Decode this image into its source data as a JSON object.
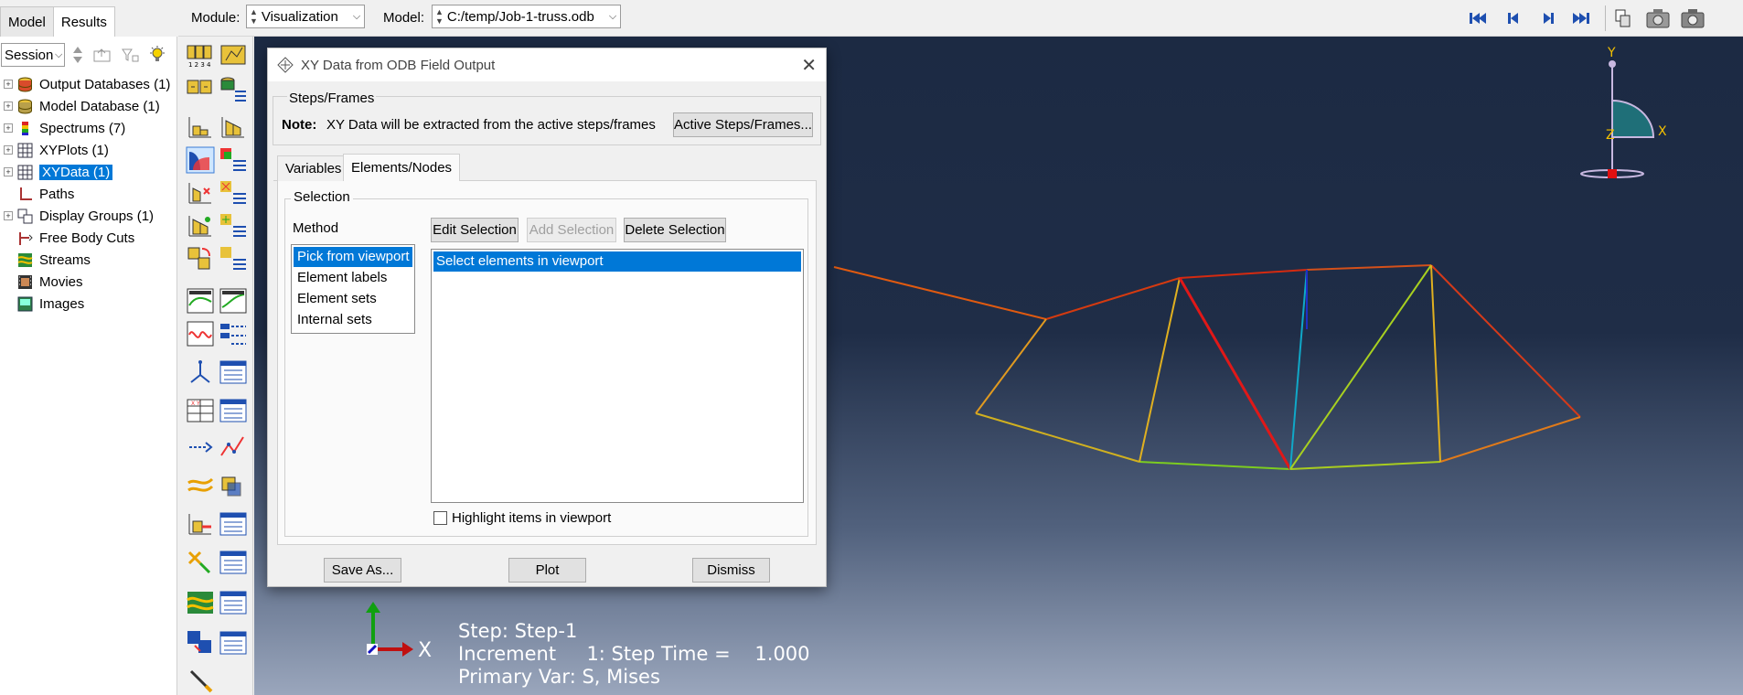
{
  "tabs": {
    "model": "Model",
    "results": "Results"
  },
  "session": {
    "value": "Session"
  },
  "tree": {
    "items": [
      {
        "label": "Output Databases (1)",
        "expandable": true,
        "icon": "database-icon"
      },
      {
        "label": "Model Database (1)",
        "expandable": true,
        "icon": "database-icon"
      },
      {
        "label": "Spectrums (7)",
        "expandable": true,
        "icon": "spectrum-icon"
      },
      {
        "label": "XYPlots (1)",
        "expandable": true,
        "icon": "grid-icon"
      },
      {
        "label": "XYData (1)",
        "expandable": true,
        "icon": "grid-icon",
        "selected": true
      },
      {
        "label": "Paths",
        "expandable": false,
        "icon": "path-icon"
      },
      {
        "label": "Display Groups (1)",
        "expandable": true,
        "icon": "display-group-icon"
      },
      {
        "label": "Free Body Cuts",
        "expandable": false,
        "icon": "free-body-icon"
      },
      {
        "label": "Streams",
        "expandable": false,
        "icon": "stream-icon"
      },
      {
        "label": "Movies",
        "expandable": false,
        "icon": "movie-icon"
      },
      {
        "label": "Images",
        "expandable": false,
        "icon": "image-icon"
      }
    ]
  },
  "topbar": {
    "module_label": "Module:",
    "module_value": "Visualization",
    "model_label": "Model:",
    "model_value": "C:/temp/Job-1-truss.odb"
  },
  "dialog": {
    "title": "XY Data from ODB Field Output",
    "steps_group": "Steps/Frames",
    "note_label": "Note:",
    "note_text": "XY Data will be extracted from the active steps/frames",
    "active_steps_button": "Active Steps/Frames...",
    "tabs": {
      "variables": "Variables",
      "elements_nodes": "Elements/Nodes"
    },
    "selection_group": "Selection",
    "method_label": "Method",
    "methods": [
      "Pick from viewport",
      "Element labels",
      "Element sets",
      "Internal sets"
    ],
    "edit_selection": "Edit Selection",
    "add_selection": "Add Selection",
    "delete_selection": "Delete Selection",
    "selection_item": "Select elements in viewport",
    "highlight_label": "Highlight items in viewport",
    "save_as": "Save As...",
    "plot": "Plot",
    "dismiss": "Dismiss"
  },
  "viewport": {
    "triad_x": "X",
    "view_y": "Y",
    "view_x": "X",
    "view_z": "Z",
    "step_line": "Step: Step-1",
    "increment_line": "Increment     1: Step Time =    1.000",
    "primary_line": "Primary Var: S, Mises"
  },
  "colors": {
    "selection": "#0078d7",
    "viewport_top": "#1c2a43",
    "viewport_bottom": "#9aa6bc"
  }
}
